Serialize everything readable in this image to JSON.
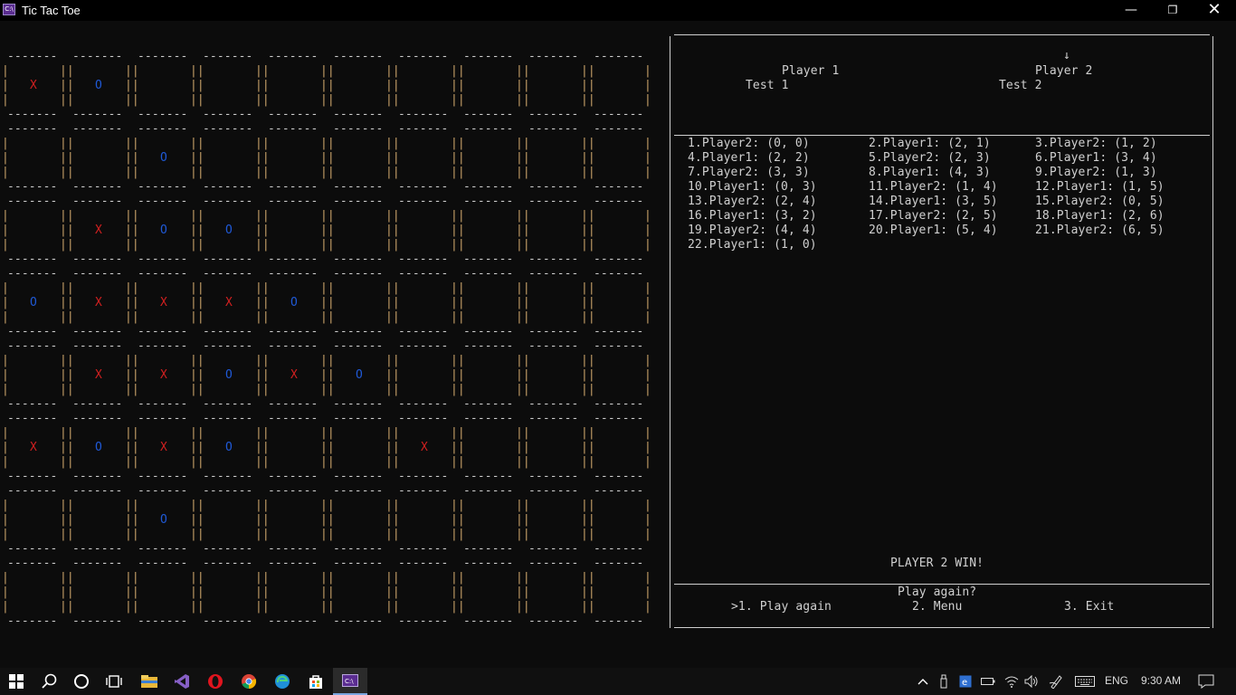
{
  "window": {
    "title": "Tic Tac Toe",
    "icon_label": "C:\\"
  },
  "board": {
    "cells": [
      [
        "X",
        "O",
        "",
        "",
        "",
        "",
        "",
        "",
        "",
        ""
      ],
      [
        "",
        "",
        "O",
        "",
        "",
        "",
        "",
        "",
        "",
        ""
      ],
      [
        "",
        "X",
        "O",
        "O",
        "",
        "",
        "",
        "",
        "",
        ""
      ],
      [
        "O",
        "X",
        "X",
        "X",
        "O",
        "",
        "",
        "",
        "",
        ""
      ],
      [
        "",
        "X",
        "X",
        "O",
        "X",
        "O",
        "",
        "",
        "",
        ""
      ],
      [
        "X",
        "O",
        "X",
        "O",
        "",
        "",
        "X",
        "",
        "",
        ""
      ],
      [
        "",
        "",
        "O",
        "",
        "",
        "",
        "",
        "",
        "",
        ""
      ],
      [
        "",
        "",
        "",
        "",
        "",
        "",
        "",
        "",
        "",
        ""
      ]
    ]
  },
  "panel": {
    "turn_arrow": "↓",
    "player1_label": "Player 1",
    "player2_label": "Player 2",
    "player1_name": "Test 1",
    "player2_name": "Test 2",
    "moves": [
      "1.Player2: (0, 0)",
      "2.Player1: (2, 1)",
      "3.Player2: (1, 2)",
      "4.Player1: (2, 2)",
      "5.Player2: (2, 3)",
      "6.Player1: (3, 4)",
      "7.Player2: (3, 3)",
      "8.Player1: (4, 3)",
      "9.Player2: (1, 3)",
      "10.Player1: (0, 3)",
      "11.Player2: (1, 4)",
      "12.Player1: (1, 5)",
      "13.Player2: (2, 4)",
      "14.Player1: (3, 5)",
      "15.Player2: (0, 5)",
      "16.Player1: (3, 2)",
      "17.Player2: (2, 5)",
      "18.Player1: (2, 6)",
      "19.Player2: (4, 4)",
      "20.Player1: (5, 4)",
      "21.Player2: (6, 5)",
      "22.Player1: (1, 0)"
    ],
    "result": "PLAYER 2 WIN!",
    "prompt": "Play again?",
    "options": [
      ">1. Play again",
      "2. Menu",
      "3. Exit"
    ]
  },
  "taskbar": {
    "language": "ENG",
    "time": "9:30 AM",
    "apps": [
      "start-icon",
      "search-icon",
      "cortana-icon",
      "task-view-icon",
      "file-explorer-icon",
      "visual-studio-icon",
      "opera-icon",
      "chrome-icon",
      "edge-icon",
      "store-icon",
      "console-icon"
    ]
  },
  "colors": {
    "x": "#d02020",
    "o": "#1f59d6",
    "grid_bar": "#c9a36a",
    "background": "#0c0c0c"
  }
}
